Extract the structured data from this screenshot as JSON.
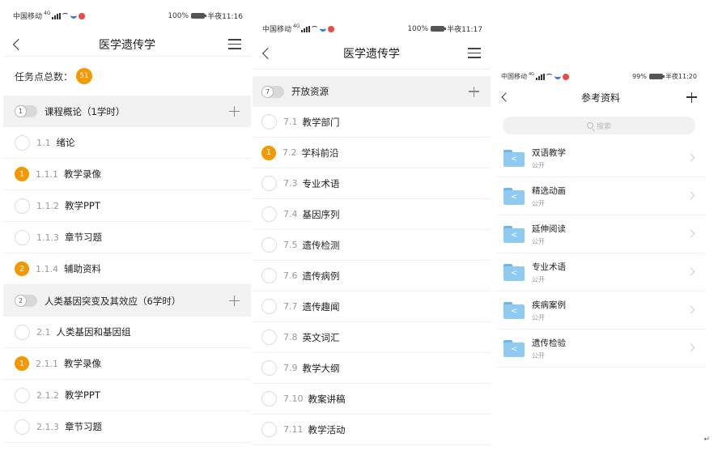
{
  "screen1": {
    "status": {
      "carrier": "中国移动",
      "net": "4G",
      "battery": "100%",
      "time": "半夜11:16"
    },
    "title": "医学遗传学",
    "task_label": "任务点总数：",
    "task_count": "51",
    "chapter1": {
      "index": "1",
      "title": "课程概论（1学时）"
    },
    "chapter2": {
      "index": "2",
      "title": "人类基因突变及其效应（6学时）"
    },
    "rows": [
      {
        "badge": "",
        "num": "1.1",
        "label": "绪论"
      },
      {
        "badge": "1",
        "num": "1.1.1",
        "label": "教学录像"
      },
      {
        "badge": "",
        "num": "1.1.2",
        "label": "教学PPT"
      },
      {
        "badge": "",
        "num": "1.1.3",
        "label": "章节习题"
      },
      {
        "badge": "2",
        "num": "1.1.4",
        "label": "辅助资料"
      }
    ],
    "rows2": [
      {
        "badge": "",
        "num": "2.1",
        "label": "人类基因和基因组"
      },
      {
        "badge": "1",
        "num": "2.1.1",
        "label": "教学录像"
      },
      {
        "badge": "",
        "num": "2.1.2",
        "label": "教学PPT"
      },
      {
        "badge": "",
        "num": "2.1.3",
        "label": "章节习题"
      }
    ]
  },
  "screen2": {
    "status": {
      "carrier": "中国移动",
      "net": "4G",
      "battery": "100%",
      "time": "半夜11:17"
    },
    "title": "医学遗传学",
    "chapter": {
      "index": "7",
      "title": "开放资源"
    },
    "rows": [
      {
        "badge": "",
        "num": "7.1",
        "label": "教学部门"
      },
      {
        "badge": "1",
        "num": "7.2",
        "label": "学科前沿"
      },
      {
        "badge": "",
        "num": "7.3",
        "label": "专业术语"
      },
      {
        "badge": "",
        "num": "7.4",
        "label": "基因序列"
      },
      {
        "badge": "",
        "num": "7.5",
        "label": "遗传检测"
      },
      {
        "badge": "",
        "num": "7.6",
        "label": "遗传病例"
      },
      {
        "badge": "",
        "num": "7.7",
        "label": "遗传趣闻"
      },
      {
        "badge": "",
        "num": "7.8",
        "label": "英文词汇"
      },
      {
        "badge": "",
        "num": "7.9",
        "label": "教学大纲"
      },
      {
        "badge": "",
        "num": "7.10",
        "label": "教案讲稿"
      },
      {
        "badge": "",
        "num": "7.11",
        "label": "教学活动"
      }
    ]
  },
  "screen3": {
    "status": {
      "carrier": "中国移动",
      "net": "4G",
      "battery": "99%",
      "time": "半夜11:20"
    },
    "title": "参考资料",
    "search_placeholder": "搜索",
    "folders": [
      {
        "name": "双语教学",
        "sub": "公开"
      },
      {
        "name": "精选动画",
        "sub": "公开"
      },
      {
        "name": "延伸阅读",
        "sub": "公开"
      },
      {
        "name": "专业术语",
        "sub": "公开"
      },
      {
        "name": "疾病案例",
        "sub": "公开"
      },
      {
        "name": "遗传检验",
        "sub": "公开"
      }
    ]
  },
  "corner_mark": "↵",
  "colors": {
    "badge": "#f39800",
    "folder": "#8fcaf2",
    "chapter_bg": "#f2f2f2"
  }
}
